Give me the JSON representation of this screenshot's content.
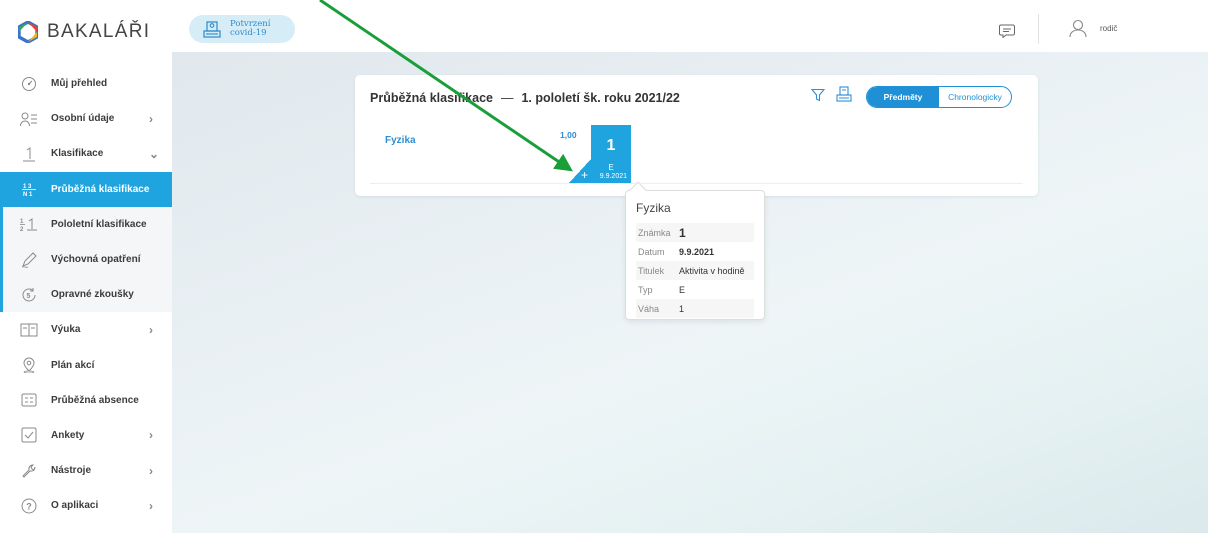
{
  "app": {
    "name": "BAKALÁŘI"
  },
  "header": {
    "covid_button": {
      "line1": "Potvrzení",
      "line2": "covid-19"
    },
    "user_label": "rodič"
  },
  "sidebar": {
    "items": [
      {
        "label": "Můj přehled",
        "icon": "dashboard-icon",
        "chevron": ""
      },
      {
        "label": "Osobní údaje",
        "icon": "person-card-icon",
        "chevron": "›"
      },
      {
        "label": "Klasifikace",
        "icon": "grade-one-icon",
        "chevron": "⌄"
      },
      {
        "label": "Průběžná klasifikace",
        "icon": "grades-grid-icon",
        "chevron": "",
        "active": true
      },
      {
        "label": "Pololetní klasifikace",
        "icon": "fraction-icon",
        "chevron": ""
      },
      {
        "label": "Výchovná opatření",
        "icon": "edit-pen-icon",
        "chevron": ""
      },
      {
        "label": "Opravné zkoušky",
        "icon": "retry-exam-icon",
        "chevron": ""
      },
      {
        "label": "Výuka",
        "icon": "book-icon",
        "chevron": "›"
      },
      {
        "label": "Plán akcí",
        "icon": "location-pin-icon",
        "chevron": ""
      },
      {
        "label": "Průběžná absence",
        "icon": "absence-icon",
        "chevron": ""
      },
      {
        "label": "Ankety",
        "icon": "checkbox-icon",
        "chevron": "›"
      },
      {
        "label": "Nástroje",
        "icon": "wrench-icon",
        "chevron": "›"
      },
      {
        "label": "O aplikaci",
        "icon": "help-icon",
        "chevron": "›"
      }
    ]
  },
  "card": {
    "title": "Průběžná klasifikace",
    "dash": "—",
    "period": "1. pololetí šk. roku 2021/22",
    "view_subjects": "Předměty",
    "view_chrono": "Chronologicky",
    "row": {
      "subject": "Fyzika",
      "average": "1,00",
      "grade": {
        "mark": "1",
        "type": "E",
        "date": "9.9.2021"
      },
      "add": "+"
    }
  },
  "tooltip": {
    "subject": "Fyzika",
    "rows": [
      {
        "key": "Známka",
        "value": "1"
      },
      {
        "key": "Datum",
        "value": "9.9.2021"
      },
      {
        "key": "Titulek",
        "value": "Aktivita v hodině"
      },
      {
        "key": "Typ",
        "value": "E"
      },
      {
        "key": "Váha",
        "value": "1"
      }
    ]
  },
  "colors": {
    "accent": "#1fa4e0",
    "arrow": "#1a9e3a",
    "grade_red": "#d0021b"
  }
}
